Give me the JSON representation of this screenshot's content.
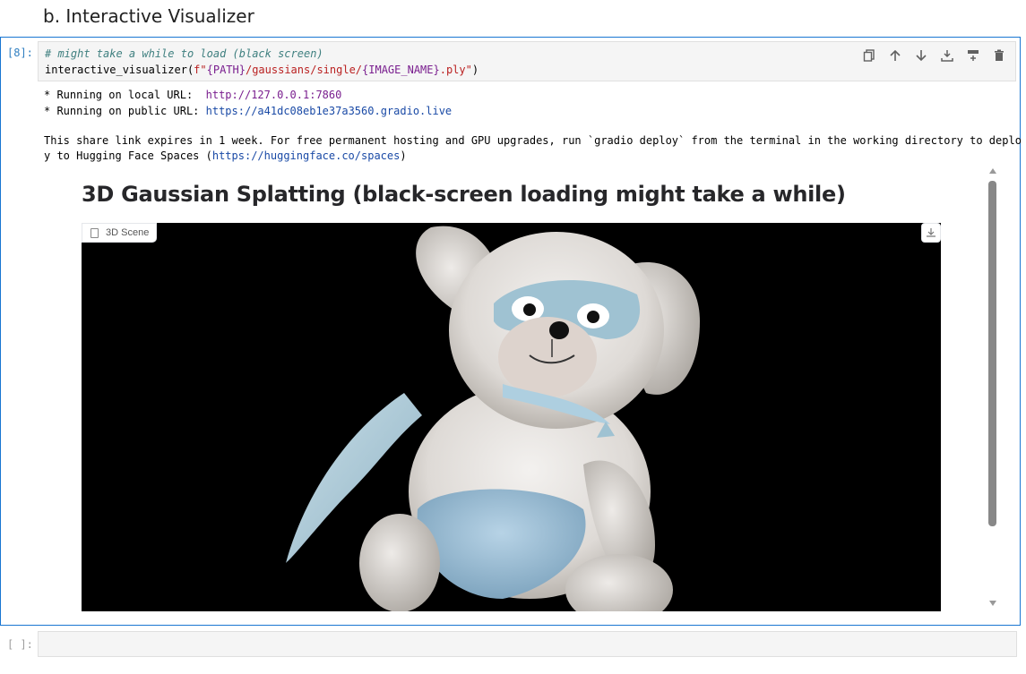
{
  "heading": "b. Interactive Visualizer",
  "cell": {
    "prompt": "[8]:",
    "code_comment": "# might take a while to load (black screen)",
    "code_func": "interactive_visualizer(",
    "code_fprefix": "f\"",
    "code_path": "{PATH}",
    "code_mid": "/gaussians/single/",
    "code_image": "{IMAGE_NAME}",
    "code_ext": ".ply\"",
    "code_close": ")"
  },
  "output": {
    "local_prefix": "* Running on local URL:  ",
    "local_url": "http://127.0.0.1:7860",
    "public_prefix": "* Running on public URL: ",
    "public_url": "https://a41dc08eb1e37a3560.gradio.live",
    "share_line1": "This share link expires in 1 week. For free permanent hosting and GPU upgrades, run `gradio deploy` from the terminal in the working directory to deplo",
    "share_line2_prefix": "y to Hugging Face Spaces (",
    "share_line2_url": "https://huggingface.co/spaces",
    "share_line2_suffix": ")"
  },
  "gradio": {
    "title": "3D Gaussian Splatting (black-screen loading might take a while)",
    "scene_label": "3D Scene"
  },
  "next_cell": {
    "prompt": "[ ]:"
  },
  "icons": [
    "duplicate-icon",
    "arrow-up-icon",
    "arrow-down-icon",
    "insert-above-icon",
    "insert-below-icon",
    "delete-icon",
    "file-icon",
    "download-icon"
  ]
}
